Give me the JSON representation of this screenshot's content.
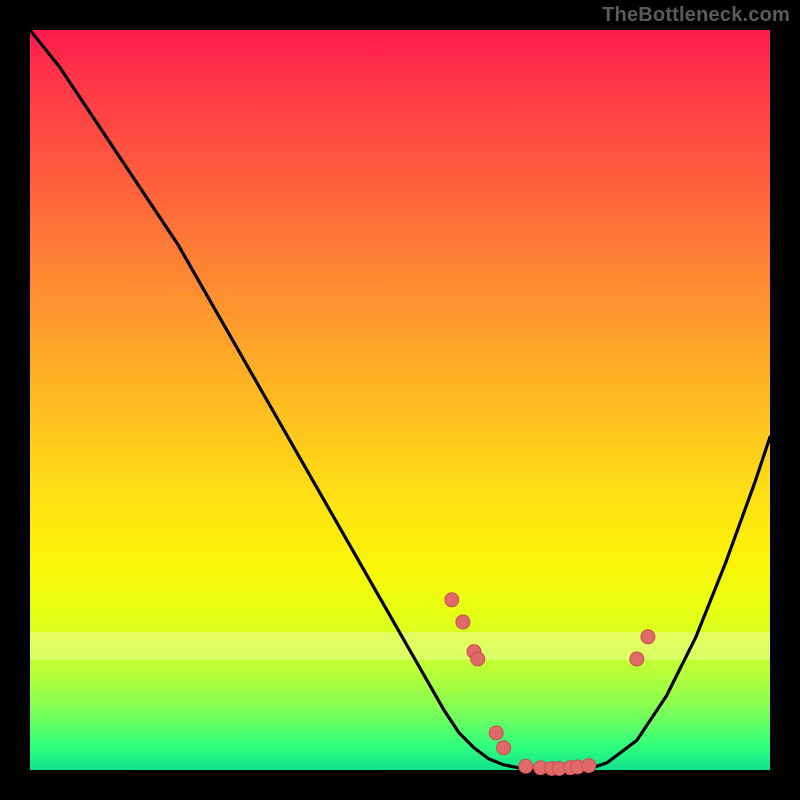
{
  "watermark": "TheBottleneck.com",
  "colors": {
    "background": "#000000",
    "curve": "#000000",
    "point_fill": "#e06a6a",
    "point_stroke": "#c94e4e"
  },
  "chart_data": {
    "type": "line",
    "title": "",
    "xlabel": "",
    "ylabel": "",
    "xlim": [
      0,
      100
    ],
    "ylim": [
      0,
      100
    ],
    "grid": false,
    "series": [
      {
        "name": "bottleneck-curve",
        "x": [
          0,
          4,
          8,
          12,
          16,
          20,
          24,
          28,
          32,
          36,
          40,
          44,
          48,
          52,
          56,
          58,
          60,
          62,
          64,
          66,
          68,
          70,
          72,
          74,
          76,
          78,
          82,
          86,
          90,
          94,
          98,
          100
        ],
        "y": [
          100,
          95,
          89,
          83,
          77,
          71,
          64,
          57,
          50,
          43,
          36,
          29,
          22,
          15,
          8,
          5,
          3,
          1.5,
          0.7,
          0.3,
          0.1,
          0,
          0,
          0,
          0.3,
          1,
          4,
          10,
          18,
          28,
          39,
          45
        ]
      }
    ],
    "points": {
      "name": "datapoints",
      "x": [
        57,
        58.5,
        60,
        60.5,
        63,
        64,
        67,
        69,
        70.5,
        71.5,
        73,
        74,
        75.5,
        82,
        83.5
      ],
      "y": [
        23,
        20,
        16,
        15,
        5,
        3,
        0.5,
        0.3,
        0.2,
        0.2,
        0.3,
        0.4,
        0.6,
        15,
        18
      ]
    }
  }
}
